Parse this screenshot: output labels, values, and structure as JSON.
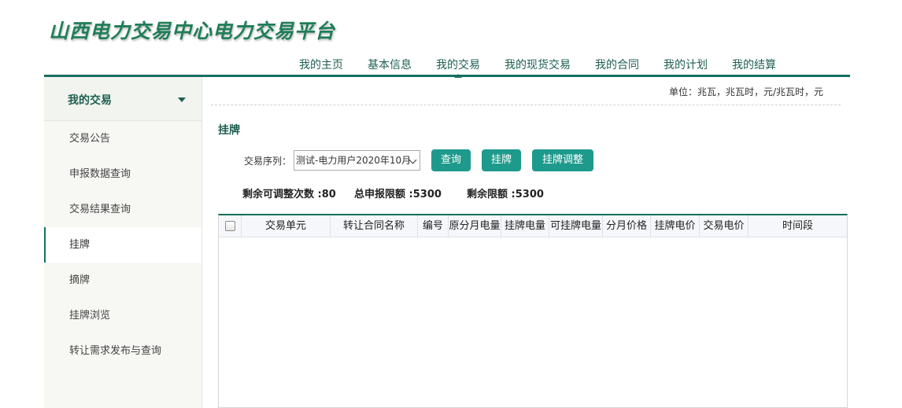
{
  "app": {
    "title": "山西电力交易中心电力交易平台"
  },
  "topnav": {
    "items": [
      {
        "label": "我的主页"
      },
      {
        "label": "基本信息"
      },
      {
        "label": "我的交易"
      },
      {
        "label": "我的现货交易"
      },
      {
        "label": "我的合同"
      },
      {
        "label": "我的计划"
      },
      {
        "label": "我的结算"
      }
    ],
    "active": "我的交易"
  },
  "sidebar": {
    "title": "我的交易",
    "items": [
      {
        "label": "交易公告"
      },
      {
        "label": "申报数据查询"
      },
      {
        "label": "交易结果查询"
      },
      {
        "label": "挂牌"
      },
      {
        "label": "摘牌"
      },
      {
        "label": "挂牌浏览"
      },
      {
        "label": "转让需求发布与查询"
      }
    ],
    "active": "挂牌"
  },
  "main": {
    "unit_text": "单位：兆瓦，兆瓦时，元/兆瓦时，元",
    "section_title": "挂牌",
    "sequence": {
      "label": "交易序列：",
      "selected": "测试-电力用户2020年10月"
    },
    "buttons": {
      "query": "查询",
      "list": "挂牌",
      "adjust": "挂牌调整"
    },
    "stats": {
      "remaining_adjust": "剩余可调整次数 :80",
      "total_limit": "总申报限额 :5300",
      "remaining_limit": "剩余限额 :5300"
    },
    "table": {
      "columns": [
        "交易单元",
        "转让合同名称",
        "编号",
        "原分月电量",
        "挂牌电量",
        "可挂牌电量",
        "分月价格",
        "挂牌电价",
        "交易电价",
        "时间段"
      ],
      "rows": []
    }
  },
  "colors": {
    "brand": "#16705e",
    "button": "#1e9a8c",
    "logo": "#1f7d57"
  }
}
